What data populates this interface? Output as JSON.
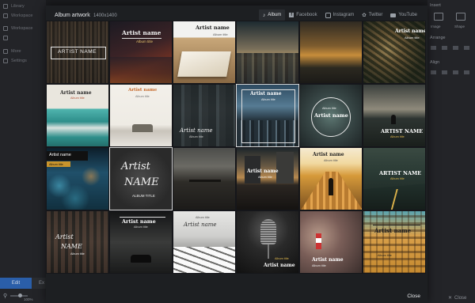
{
  "app": {
    "left_rail": [
      "Library",
      "Workspace",
      "Workspace",
      "More",
      "Settings"
    ],
    "edit_label": "Edit",
    "export_label": "Ex",
    "zoom_value": "100%",
    "right_panel": {
      "insert_label": "Insert",
      "image_label": "Image",
      "shape_label": "Shape",
      "arrange_label": "Arrange",
      "align_label": "Align",
      "close_label": "Close"
    }
  },
  "modal": {
    "title": "Album artwork",
    "size": "1400x1400",
    "tabs": [
      {
        "label": "Album",
        "icon": "music-note-icon",
        "active": true
      },
      {
        "label": "Facebook",
        "icon": "facebook-icon",
        "active": false
      },
      {
        "label": "Instagram",
        "icon": "instagram-icon",
        "active": false
      },
      {
        "label": "Twitter",
        "icon": "twitter-icon",
        "active": false
      },
      {
        "label": "YouTube",
        "icon": "youtube-icon",
        "active": false
      }
    ],
    "close_label": "Close"
  },
  "templates": {
    "artist_upper": "ARTIST NAME",
    "artist_title": "Artist name",
    "artist_script_1": "Artist",
    "artist_script_2": "NAME",
    "album_title": "Album title",
    "album_upper": "ALBUM TITLE"
  }
}
